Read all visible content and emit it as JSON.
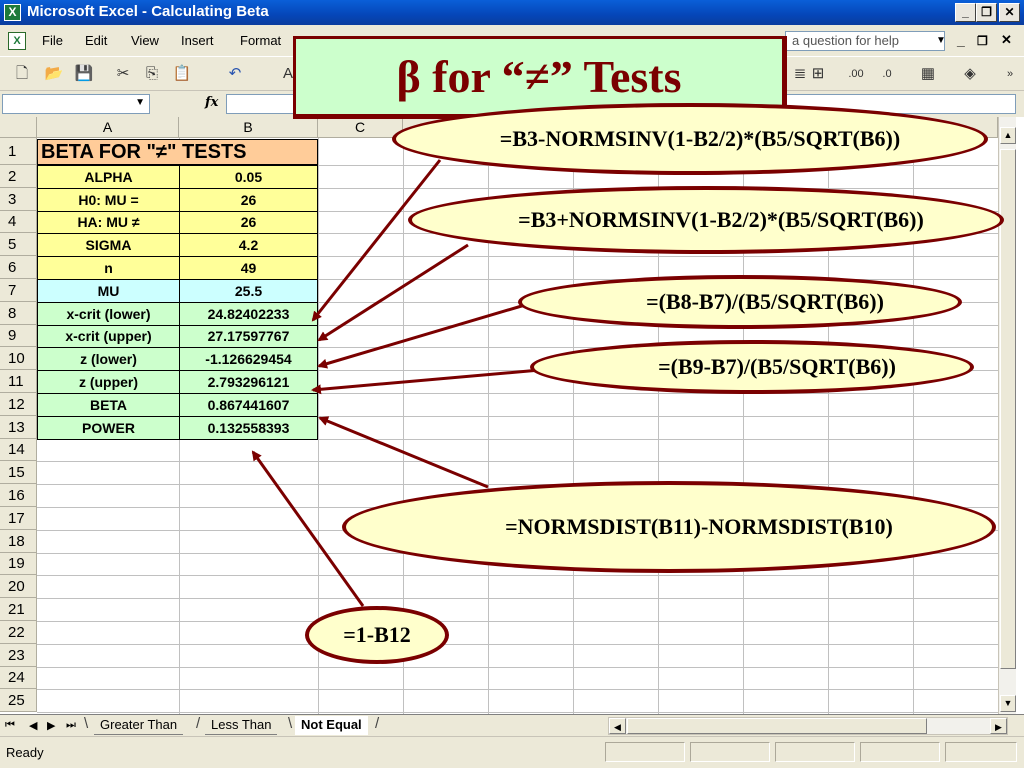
{
  "window": {
    "title": "Microsoft Excel - Calculating  Beta",
    "min": "_",
    "max": "❐",
    "close": "✕"
  },
  "menubar": {
    "items": [
      "File",
      "Edit",
      "View",
      "Insert",
      "Format"
    ],
    "ask_placeholder": "a question for help"
  },
  "formula_bar": {
    "fx": "fx",
    "name_box": "",
    "formula": ""
  },
  "columns": [
    "A",
    "B",
    "C"
  ],
  "rows": [
    "1",
    "2",
    "3",
    "4",
    "5",
    "6",
    "7",
    "8",
    "9",
    "10",
    "11",
    "12",
    "13",
    "14",
    "15",
    "16",
    "17",
    "18",
    "19",
    "20",
    "21",
    "22",
    "23",
    "24",
    "25"
  ],
  "table": {
    "header": "BETA FOR \"≠\" TESTS",
    "rows": [
      {
        "label": "ALPHA",
        "value": "0.05",
        "color": "#ffff99"
      },
      {
        "label": "H0:  MU =",
        "value": "26",
        "color": "#ffff99"
      },
      {
        "label": "HA: MU ≠",
        "value": "26",
        "color": "#ffff99"
      },
      {
        "label": "SIGMA",
        "value": "4.2",
        "color": "#ffff99"
      },
      {
        "label": "n",
        "value": "49",
        "color": "#ffff99"
      },
      {
        "label": "MU",
        "value": "25.5",
        "color": "#ccffff"
      },
      {
        "label": "x-crit (lower)",
        "value": "24.82402233",
        "color": "#ccffcc"
      },
      {
        "label": "x-crit (upper)",
        "value": "27.17597767",
        "color": "#ccffcc"
      },
      {
        "label": "z (lower)",
        "value": "-1.126629454",
        "color": "#ccffcc"
      },
      {
        "label": "z (upper)",
        "value": "2.793296121",
        "color": "#ccffcc"
      },
      {
        "label": "BETA",
        "value": "0.867441607",
        "color": "#ccffcc"
      },
      {
        "label": "POWER",
        "value": "0.132558393",
        "color": "#ccffcc"
      }
    ]
  },
  "slide_title": "β for “≠” Tests",
  "callouts": {
    "xcrit_lower": "=B3-NORMSINV(1-B2/2)*(B5/SQRT(B6))",
    "xcrit_upper": "=B3+NORMSINV(1-B2/2)*(B5/SQRT(B6))",
    "z_lower": "=(B8-B7)/(B5/SQRT(B6))",
    "z_upper": "=(B9-B7)/(B5/SQRT(B6))",
    "beta": "=NORMSDIST(B11)-NORMSDIST(B10)",
    "power": "=1-B12"
  },
  "sheet_tabs": [
    "Greater Than",
    "Less Than",
    "Not Equal"
  ],
  "active_tab": "Not Equal",
  "status": "Ready",
  "colors": {
    "header": "#ffcc99",
    "accent": "#7a0000",
    "callout_fill": "#ffffcc",
    "title_fill": "#ccffcc"
  }
}
